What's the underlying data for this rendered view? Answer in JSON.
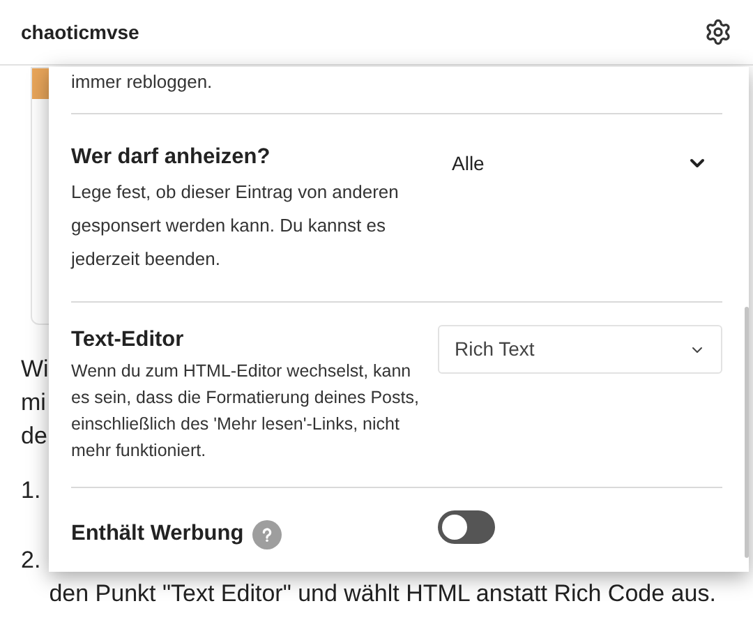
{
  "header": {
    "title": "chaoticmvse"
  },
  "background": {
    "fragments": [
      "Wi",
      "mi",
      "de"
    ],
    "list": [
      {
        "number": "1."
      },
      {
        "number": "2.",
        "text": "den Punkt \"Text Editor\" und wählt HTML anstatt Rich Code aus."
      }
    ]
  },
  "panel": {
    "top_text": "immer rebloggen.",
    "settings": [
      {
        "kind": "plain-select",
        "title": "Wer darf anheizen?",
        "description": "Lege fest, ob dieser Eintrag von anderen gesponsert werden kann. Du kannst es jederzeit beenden.",
        "value": "Alle"
      },
      {
        "kind": "boxed-select",
        "title": "Text-Editor",
        "description": "Wenn du zum HTML-Editor wechselst, kann es sein, dass die Formatierung deines Posts, einschließlich des 'Mehr lesen'-Links, nicht mehr funktioniert.",
        "value": "Rich Text"
      },
      {
        "kind": "toggle",
        "title": "Enthält Werbung",
        "help": true,
        "on": false
      }
    ]
  }
}
